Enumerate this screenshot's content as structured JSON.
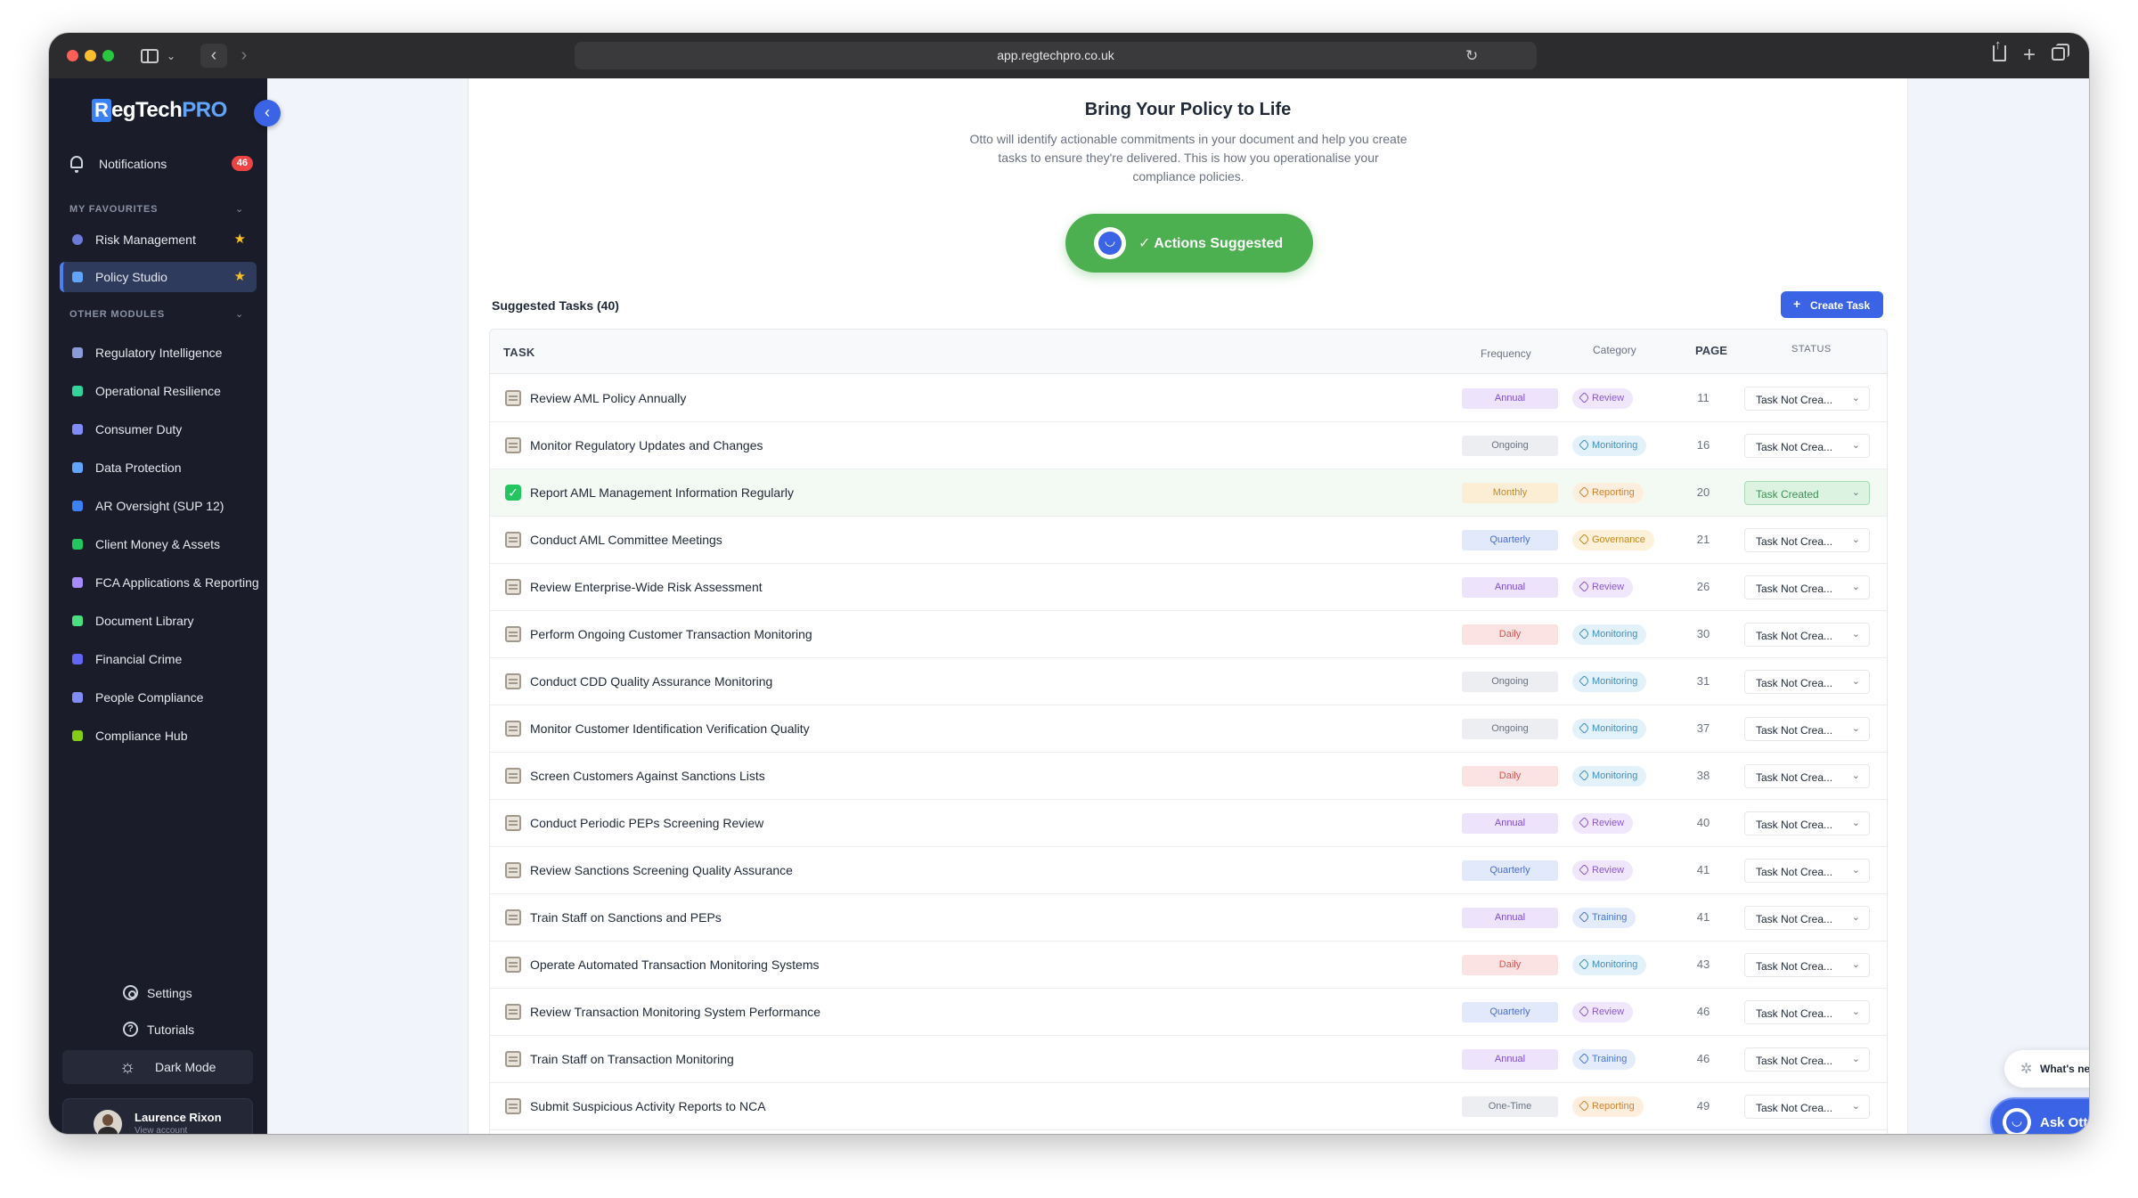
{
  "browser": {
    "url": "app.regtechpro.co.uk"
  },
  "app": {
    "logo_letter": "R",
    "logo_main": "egTech",
    "logo_accent": "PRO",
    "notifications_label": "Notifications",
    "notifications_count": "46",
    "favourites_label": "MY FAVOURITES",
    "favourites": [
      {
        "label": "Risk Management",
        "icon_color": "#6c7bd9",
        "starred": true,
        "active": false
      },
      {
        "label": "Policy Studio",
        "icon_color": "#60a5fa",
        "starred": true,
        "active": true
      }
    ],
    "other_label": "OTHER MODULES",
    "modules": [
      {
        "label": "Regulatory Intelligence",
        "icon_color": "#8b9bd9"
      },
      {
        "label": "Operational Resilience",
        "icon_color": "#34d399"
      },
      {
        "label": "Consumer Duty",
        "icon_color": "#818cf8"
      },
      {
        "label": "Data Protection",
        "icon_color": "#60a5fa"
      },
      {
        "label": "AR Oversight (SUP 12)",
        "icon_color": "#3b82f6"
      },
      {
        "label": "Client Money & Assets",
        "icon_color": "#22c55e"
      },
      {
        "label": "FCA Applications & Reporting",
        "icon_color": "#a78bfa"
      },
      {
        "label": "Document Library",
        "icon_color": "#4ade80"
      },
      {
        "label": "Financial Crime",
        "icon_color": "#6366f1"
      },
      {
        "label": "People Compliance",
        "icon_color": "#818cf8"
      },
      {
        "label": "Compliance Hub",
        "icon_color": "#84cc16"
      }
    ],
    "settings_label": "Settings",
    "tutorials_label": "Tutorials",
    "dark_mode_label": "Dark Mode",
    "user": {
      "name": "Laurence Rixon",
      "sub": "View account"
    }
  },
  "hero": {
    "title": "Bring Your Policy to Life",
    "description": "Otto will identify actionable commitments in your document and help you create tasks to ensure they're delivered. This is how you operationalise your compliance policies.",
    "button_label": "✓ Actions Suggested"
  },
  "tasks": {
    "title": "Suggested Tasks (40)",
    "create_label": "Create Task",
    "columns": {
      "task": "TASK",
      "frequency": "Frequency",
      "category": "Category",
      "page": "PAGE",
      "status": "STATUS"
    },
    "rows": [
      {
        "name": "Review AML Policy Annually",
        "frequency": "Annual",
        "category": "Review",
        "page": "11",
        "status": "Task Not Crea...",
        "done": false
      },
      {
        "name": "Monitor Regulatory Updates and Changes",
        "frequency": "Ongoing",
        "category": "Monitoring",
        "page": "16",
        "status": "Task Not Crea...",
        "done": false
      },
      {
        "name": "Report AML Management Information Regularly",
        "frequency": "Monthly",
        "category": "Reporting",
        "page": "20",
        "status": "Task Created",
        "done": true
      },
      {
        "name": "Conduct AML Committee Meetings",
        "frequency": "Quarterly",
        "category": "Governance",
        "page": "21",
        "status": "Task Not Crea...",
        "done": false
      },
      {
        "name": "Review Enterprise-Wide Risk Assessment",
        "frequency": "Annual",
        "category": "Review",
        "page": "26",
        "status": "Task Not Crea...",
        "done": false
      },
      {
        "name": "Perform Ongoing Customer Transaction Monitoring",
        "frequency": "Daily",
        "category": "Monitoring",
        "page": "30",
        "status": "Task Not Crea...",
        "done": false
      },
      {
        "name": "Conduct CDD Quality Assurance Monitoring",
        "frequency": "Ongoing",
        "category": "Monitoring",
        "page": "31",
        "status": "Task Not Crea...",
        "done": false
      },
      {
        "name": "Monitor Customer Identification Verification Quality",
        "frequency": "Ongoing",
        "category": "Monitoring",
        "page": "37",
        "status": "Task Not Crea...",
        "done": false
      },
      {
        "name": "Screen Customers Against Sanctions Lists",
        "frequency": "Daily",
        "category": "Monitoring",
        "page": "38",
        "status": "Task Not Crea...",
        "done": false
      },
      {
        "name": "Conduct Periodic PEPs Screening Review",
        "frequency": "Annual",
        "category": "Review",
        "page": "40",
        "status": "Task Not Crea...",
        "done": false
      },
      {
        "name": "Review Sanctions Screening Quality Assurance",
        "frequency": "Quarterly",
        "category": "Review",
        "page": "41",
        "status": "Task Not Crea...",
        "done": false
      },
      {
        "name": "Train Staff on Sanctions and PEPs",
        "frequency": "Annual",
        "category": "Training",
        "page": "41",
        "status": "Task Not Crea...",
        "done": false
      },
      {
        "name": "Operate Automated Transaction Monitoring Systems",
        "frequency": "Daily",
        "category": "Monitoring",
        "page": "43",
        "status": "Task Not Crea...",
        "done": false
      },
      {
        "name": "Review Transaction Monitoring System Performance",
        "frequency": "Quarterly",
        "category": "Review",
        "page": "46",
        "status": "Task Not Crea...",
        "done": false
      },
      {
        "name": "Train Staff on Transaction Monitoring",
        "frequency": "Annual",
        "category": "Training",
        "page": "46",
        "status": "Task Not Crea...",
        "done": false
      },
      {
        "name": "Submit Suspicious Activity Reports to NCA",
        "frequency": "One-Time",
        "category": "Reporting",
        "page": "49",
        "status": "Task Not Crea...",
        "done": false
      }
    ],
    "frequency_colors": {
      "Annual": {
        "bg": "#ede4fb",
        "fg": "#7c4dcc"
      },
      "Ongoing": {
        "bg": "#eceef1",
        "fg": "#6b7280"
      },
      "Monthly": {
        "bg": "#fbeed5",
        "fg": "#c58a2b"
      },
      "Quarterly": {
        "bg": "#e2e9fb",
        "fg": "#4a6bd6"
      },
      "Daily": {
        "bg": "#fce3e3",
        "fg": "#d9534f"
      },
      "One-Time": {
        "bg": "#eceef1",
        "fg": "#6b7280"
      }
    },
    "category_colors": {
      "Review": {
        "bg": "#f1e7fc",
        "fg": "#8a56d6"
      },
      "Monitoring": {
        "bg": "#e3f1fa",
        "fg": "#3d8fbf"
      },
      "Reporting": {
        "bg": "#fdeedd",
        "fg": "#d5822f"
      },
      "Governance": {
        "bg": "#fdf1d9",
        "fg": "#c8871d"
      },
      "Training": {
        "bg": "#e4ecfb",
        "fg": "#4a75d6"
      }
    }
  },
  "floating": {
    "whats_new": "What's new",
    "ask_otto": "Ask Otto"
  }
}
